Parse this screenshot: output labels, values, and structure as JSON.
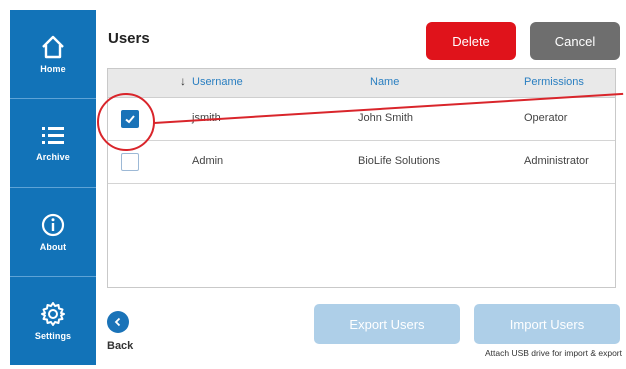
{
  "sidebar": {
    "items": [
      {
        "label": "Home",
        "icon": "home-icon"
      },
      {
        "label": "Archive",
        "icon": "list-icon"
      },
      {
        "label": "About",
        "icon": "info-icon"
      },
      {
        "label": "Settings",
        "icon": "gear-icon"
      }
    ]
  },
  "header": {
    "title": "Users",
    "delete_label": "Delete",
    "cancel_label": "Cancel"
  },
  "table": {
    "columns": [
      "Username",
      "Name",
      "Permissions"
    ],
    "sort_indicator": "↓",
    "rows": [
      {
        "checked": true,
        "username": "jsmith",
        "name": "John Smith",
        "permissions": "Operator"
      },
      {
        "checked": false,
        "username": "Admin",
        "name": "BioLife Solutions",
        "permissions": "Administrator"
      }
    ]
  },
  "footer": {
    "back_label": "Back",
    "export_label": "Export Users",
    "import_label": "Import Users",
    "usb_hint": "Attach USB drive for import & export"
  },
  "colors": {
    "sidebar": "#1273b8",
    "delete": "#e0131b",
    "cancel": "#6e6e6e",
    "disabled_button": "#aecfe8",
    "annotation": "#d9252b"
  }
}
